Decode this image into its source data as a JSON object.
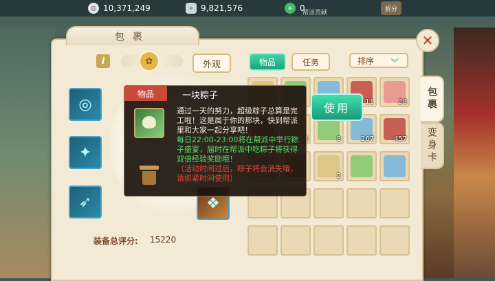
{
  "currency": {
    "silver": "10,371,249",
    "gems": "9,821,576",
    "jade": "0",
    "jade_sub_label": "帮派贡献",
    "shop_button": "折分"
  },
  "panel": {
    "title": "包裹",
    "close_icon": "close-icon",
    "side_tabs": [
      "包裹",
      "变身卡"
    ]
  },
  "toolbar": {
    "appearance_btn": "外观",
    "tab_items": "物品",
    "tab_tasks": "任务",
    "sort_btn": "排序"
  },
  "equipment": {
    "score_label": "装备总评分:",
    "score_value": "15220"
  },
  "grid": {
    "rows": [
      [
        {
          "count": ""
        },
        {
          "count": ""
        },
        {
          "count": ""
        },
        {
          "count": "11"
        },
        {
          "count": "28"
        }
      ],
      [
        {
          "count": ""
        },
        {
          "count": "8"
        },
        {
          "count": "8"
        },
        {
          "count": "267"
        },
        {
          "count": "457"
        }
      ],
      [
        {
          "count": "6"
        },
        {
          "count": ""
        },
        {
          "count": "2"
        },
        {
          "count": ""
        },
        {
          "count": ""
        }
      ],
      [
        {
          "count": ""
        },
        {
          "count": ""
        },
        {
          "count": ""
        },
        {
          "count": ""
        },
        {
          "count": ""
        }
      ],
      [
        {
          "count": ""
        },
        {
          "count": ""
        },
        {
          "count": ""
        },
        {
          "count": ""
        },
        {
          "count": ""
        }
      ]
    ]
  },
  "tooltip": {
    "tag": "物品",
    "name": "一块粽子",
    "desc": "通过一天的努力，超级粽子总算是完工啦！这是属于你的那块，快到帮派里和大家一起分享吧！",
    "event": "每日22:00-23:00将在帮派中举行粽子盛宴，届时在帮派中吃粽子将获得双倍经验奖励哦！",
    "warning": "（活动时间过后，粽子将会消失哦，请抓紧时间使用）",
    "use_btn": "使用"
  }
}
